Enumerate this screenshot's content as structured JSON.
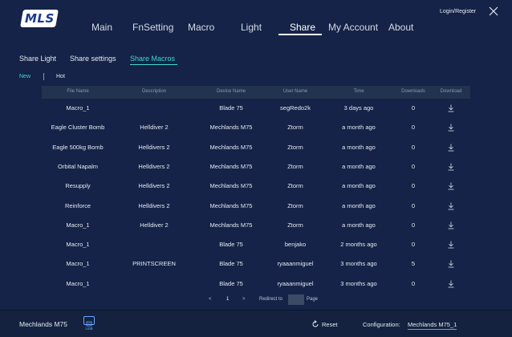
{
  "logo": "MLS",
  "header": {
    "login_label": "Login/Register",
    "nav": [
      "Main",
      "FnSetting",
      "Macro",
      "Light",
      "Share",
      "My Account",
      "About"
    ],
    "active_nav": "Share"
  },
  "subtabs": [
    "Share Light",
    "Share settings",
    "Share Macros"
  ],
  "active_subtab": "Share Macros",
  "filters": {
    "new": "New",
    "hot": "Hot",
    "active": "New"
  },
  "table": {
    "columns": [
      "File Name",
      "Description",
      "Device Name",
      "User Name",
      "Time",
      "Downloads",
      "Download"
    ],
    "rows": [
      [
        "Macro_1",
        "",
        "Blade 75",
        "segRedo2k",
        "3 days ago",
        "0"
      ],
      [
        "Eagle Cluster Bomb",
        "Helldiver 2",
        "Mechlands M75",
        "Ztorm",
        "a month ago",
        "0"
      ],
      [
        "Eagle 500kg Bomb",
        "Helldivers 2",
        "Mechlands M75",
        "Ztorm",
        "a month ago",
        "0"
      ],
      [
        "Orbital Napalm",
        "Helldivers 2",
        "Mechlands M75",
        "Ztorm",
        "a month ago",
        "0"
      ],
      [
        "Resupply",
        "Helldivers 2",
        "Mechlands M75",
        "Ztorm",
        "a month ago",
        "0"
      ],
      [
        "Reinforce",
        "Helldivers 2",
        "Mechlands M75",
        "Ztorm",
        "a month ago",
        "0"
      ],
      [
        "Macro_1",
        "Helldiver 2",
        "Mechlands M75",
        "Ztorm",
        "a month ago",
        "0"
      ],
      [
        "Macro_1",
        "",
        "Blade 75",
        "benjako",
        "2 months ago",
        "0"
      ],
      [
        "Macro_1",
        "PRINTSCREEN",
        "Blade 75",
        "ryaaanmiguel",
        "3 months ago",
        "5"
      ],
      [
        "Macro_1",
        "",
        "Blade 75",
        "ryaaanmiguel",
        "3 months ago",
        "0"
      ]
    ]
  },
  "pagination": {
    "prev": "<",
    "current_page": "1",
    "next": ">",
    "redirect_label": "Redirect to",
    "page_label": "Page",
    "page_input_value": ""
  },
  "footer": {
    "device": "Mechlands M75",
    "connection": "USB",
    "reset_label": "Reset",
    "config_label": "Configuration:",
    "config_value": "Mechlands M75_1"
  },
  "colors": {
    "background": "#142347",
    "accent": "#3fd7d2",
    "header_row": "#22334f",
    "usb": "#6aa7ff"
  },
  "icons": [
    "close-icon",
    "download-icon",
    "reset-icon",
    "usb-icon"
  ]
}
